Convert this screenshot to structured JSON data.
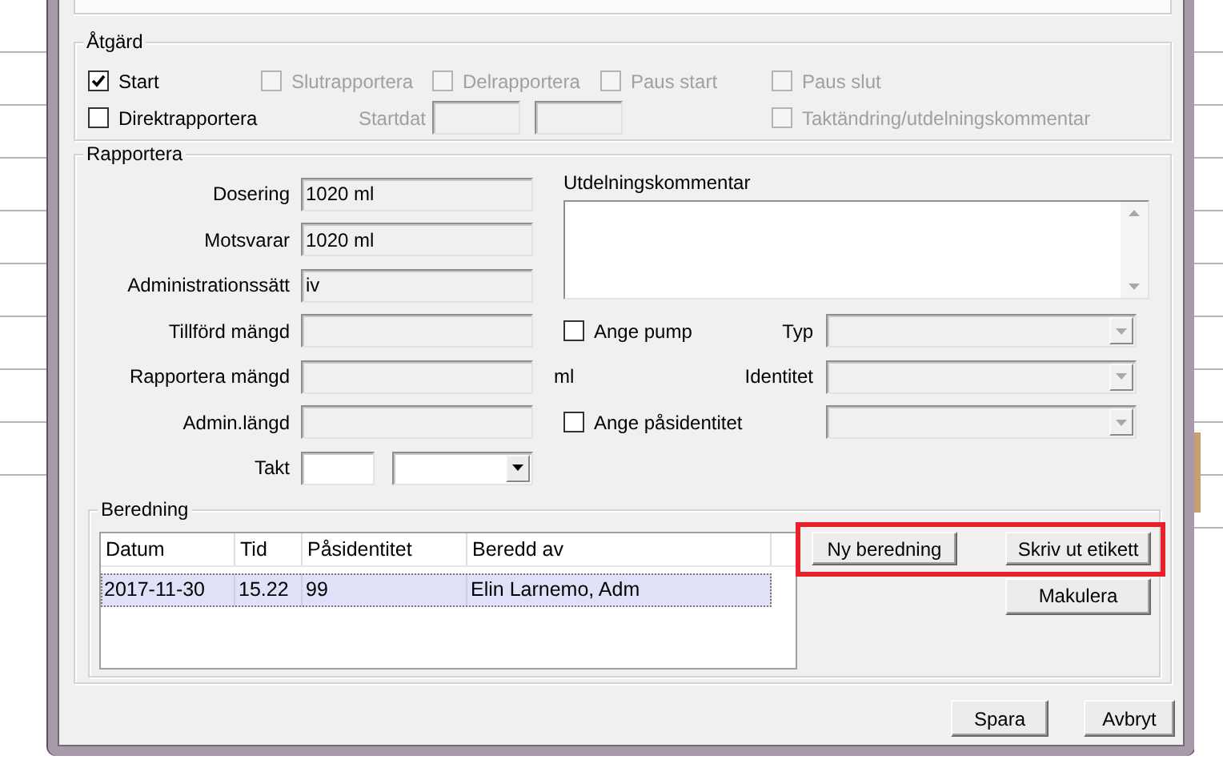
{
  "action_group": {
    "title": "Åtgärd",
    "checks": [
      {
        "label": "Start",
        "checked": true,
        "disabled": false
      },
      {
        "label": "Slutrapportera",
        "checked": false,
        "disabled": true
      },
      {
        "label": "Delrapportera",
        "checked": false,
        "disabled": true
      },
      {
        "label": "Paus start",
        "checked": false,
        "disabled": true
      },
      {
        "label": "Paus slut",
        "checked": false,
        "disabled": true
      },
      {
        "label": "Direktrapportera",
        "checked": false,
        "disabled": false
      },
      {
        "label": "Taktändring/utdelningskommentar",
        "checked": false,
        "disabled": true
      }
    ],
    "start_date": {
      "label": "Startdat",
      "fields": [
        {
          "disabled": true
        },
        {
          "disabled": true
        }
      ]
    }
  },
  "report_group": {
    "title": "Rapportera",
    "fields": [
      {
        "label": "Dosering",
        "value": "1020 ml",
        "disabled": true
      },
      {
        "label": "Motsvarar",
        "value": "1020 ml",
        "disabled": true
      },
      {
        "label": "Administrationssätt",
        "value": "iv",
        "disabled": true
      },
      {
        "label": "Tillförd mängd",
        "disabled": true
      },
      {
        "label": "Rapportera mängd",
        "disabled": true,
        "unit": "ml"
      },
      {
        "label": "Admin.längd",
        "disabled": true
      }
    ],
    "rate": {
      "label": "Takt",
      "field": {
        "disabled": false
      },
      "unit_combo": {
        "disabled": false
      }
    },
    "comment": {
      "label": "Utdelningskommentar"
    },
    "pump": {
      "check": {
        "label": "Ange pump",
        "checked": false,
        "disabled": false
      },
      "type": {
        "label": "Typ",
        "disabled": true
      },
      "identity": {
        "label": "Identitet",
        "disabled": true
      }
    },
    "bag": {
      "check": {
        "label": "Ange påsidentitet",
        "checked": false,
        "disabled": false
      },
      "combo": {
        "disabled": true
      }
    }
  },
  "preparation_group": {
    "title": "Beredning",
    "table": {
      "columns": [
        "Datum",
        "Tid",
        "Påsidentitet",
        "Beredd av"
      ],
      "rows": [
        {
          "cells": [
            "2017-11-30",
            "15.22",
            "99",
            "Elin Larnemo, Adm"
          ],
          "selected": true
        }
      ]
    },
    "buttons": [
      {
        "label": "Ny beredning",
        "highlighted": true
      },
      {
        "label": "Skriv ut etikett",
        "highlighted": true
      },
      {
        "label": "Makulera",
        "highlighted": false
      }
    ]
  },
  "footer_buttons": [
    "Spara",
    "Avbryt"
  ]
}
